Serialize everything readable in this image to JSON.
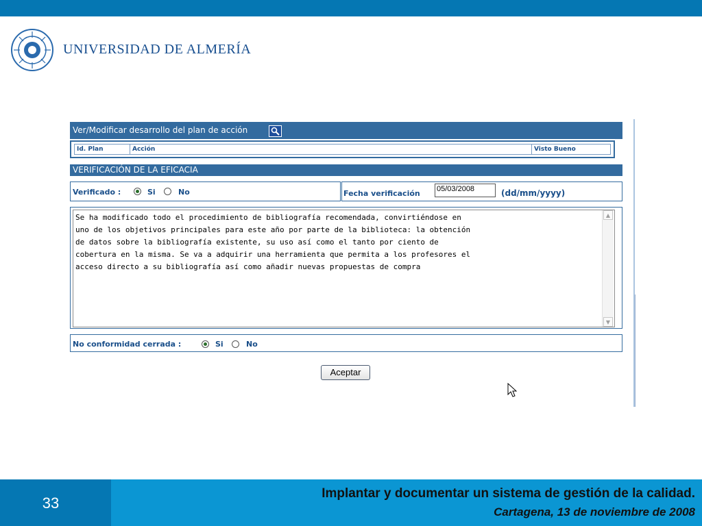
{
  "header": {
    "logo_icon": "university-seal-icon",
    "university_name": "UNIVERSIDAD DE ALMERÍA",
    "brand_color": "#0577b3"
  },
  "form": {
    "plan_section_title": "Ver/Modificar desarrollo del plan de acción",
    "search_icon": "magnifier-icon",
    "plan_table": {
      "columns": [
        "Id. Plan",
        "Acción",
        "Visto Bueno"
      ]
    },
    "verification_title": "VERIFICACIÓN DE LA EFICACIA",
    "verificado_label": "Verificado :",
    "verificado_options": [
      {
        "label": "Si",
        "checked": true
      },
      {
        "label": "No",
        "checked": false
      }
    ],
    "fecha_label": "Fecha verificación",
    "fecha_value": "05/03/2008",
    "fecha_format": "(dd/mm/yyyy)",
    "comments": "Se ha modificado todo el procedimiento de bibliografía recomendada, convirtiéndose en\nuno de los objetivos principales para este año por parte de la biblioteca: la obtención\nde datos sobre la bibliografía existente, su uso así como el tanto por ciento de\ncobertura en la misma. Se va a adquirir una herramienta que permita a los profesores el\nacceso directo a su bibliografía así como añadir nuevas propuestas de compra",
    "no_conformidad_label": "No conformidad cerrada :",
    "no_conformidad_options": [
      {
        "label": "Si",
        "checked": true
      },
      {
        "label": "No",
        "checked": false
      }
    ],
    "accept_label": "Aceptar"
  },
  "footer": {
    "slide_number": "33",
    "title": "Implantar y documentar un sistema de gestión de la calidad.",
    "subtitle": "Cartagena, 13 de noviembre de 2008"
  }
}
